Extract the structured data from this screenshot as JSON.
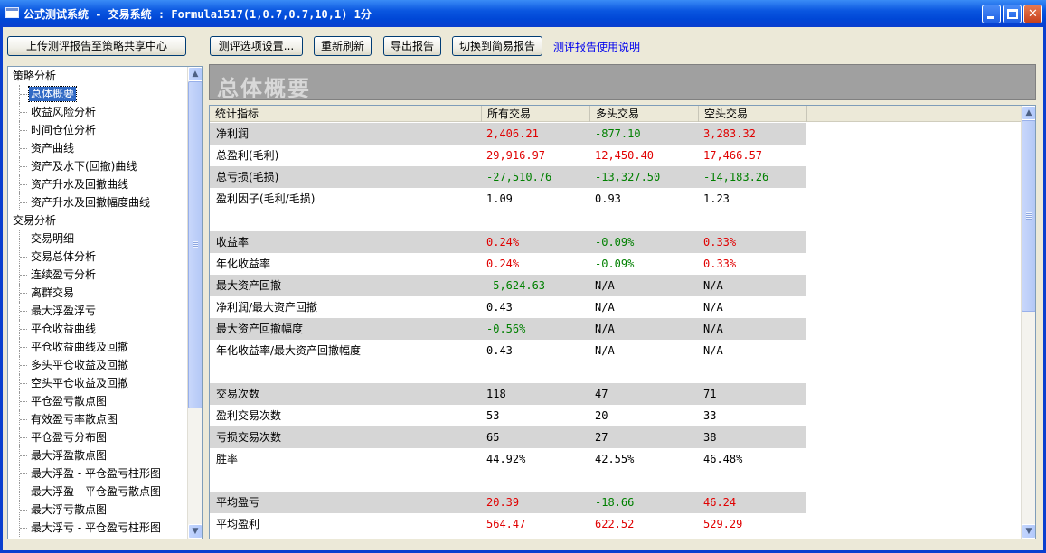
{
  "window": {
    "title": "公式测试系统 - 交易系统 : Formula1517(1,0.7,0.7,10,1) 1分"
  },
  "toolbar": {
    "upload": "上传测评报告至策略共享中心",
    "options": "测评选项设置...",
    "refresh": "重新刷新",
    "export": "导出报告",
    "simple": "切换到简易报告",
    "help_link": "测评报告使用说明"
  },
  "tree": {
    "groups": [
      {
        "label": "策略分析",
        "items": [
          "总体概要",
          "收益风险分析",
          "时间仓位分析",
          "资产曲线",
          "资产及水下(回撤)曲线",
          "资产升水及回撤曲线",
          "资产升水及回撤幅度曲线"
        ]
      },
      {
        "label": "交易分析",
        "items": [
          "交易明细",
          "交易总体分析",
          "连续盈亏分析",
          "离群交易",
          "最大浮盈浮亏",
          "平仓收益曲线",
          "平仓收益曲线及回撤",
          "多头平仓收益及回撤",
          "空头平仓收益及回撤",
          "平仓盈亏散点图",
          "有效盈亏率散点图",
          "平仓盈亏分布图",
          "最大浮盈散点图",
          "最大浮盈 - 平仓盈亏柱形图",
          "最大浮盈 - 平仓盈亏散点图",
          "最大浮亏散点图",
          "最大浮亏 - 平仓盈亏柱形图"
        ]
      }
    ],
    "selected": "总体概要"
  },
  "report": {
    "title": "总体概要",
    "headers": [
      "统计指标",
      "所有交易",
      "多头交易",
      "空头交易"
    ],
    "rows": [
      {
        "label": "净利润",
        "shaded": true,
        "values": [
          [
            "2,406.21",
            "pos"
          ],
          [
            "-877.10",
            "neg"
          ],
          [
            "3,283.32",
            "pos"
          ]
        ]
      },
      {
        "label": "总盈利(毛利)",
        "shaded": false,
        "values": [
          [
            "29,916.97",
            "pos"
          ],
          [
            "12,450.40",
            "pos"
          ],
          [
            "17,466.57",
            "pos"
          ]
        ]
      },
      {
        "label": "总亏损(毛损)",
        "shaded": true,
        "values": [
          [
            "-27,510.76",
            "neg"
          ],
          [
            "-13,327.50",
            "neg"
          ],
          [
            "-14,183.26",
            "neg"
          ]
        ]
      },
      {
        "label": "盈利因子(毛利/毛损)",
        "shaded": false,
        "values": [
          [
            "1.09",
            "neu"
          ],
          [
            "0.93",
            "neu"
          ],
          [
            "1.23",
            "neu"
          ]
        ]
      },
      {
        "label": "",
        "shaded": false,
        "values": []
      },
      {
        "label": "收益率",
        "shaded": true,
        "values": [
          [
            "0.24%",
            "pos"
          ],
          [
            "-0.09%",
            "neg"
          ],
          [
            "0.33%",
            "pos"
          ]
        ]
      },
      {
        "label": "年化收益率",
        "shaded": false,
        "values": [
          [
            "0.24%",
            "pos"
          ],
          [
            "-0.09%",
            "neg"
          ],
          [
            "0.33%",
            "pos"
          ]
        ]
      },
      {
        "label": "最大资产回撤",
        "shaded": true,
        "values": [
          [
            "-5,624.63",
            "neg"
          ],
          [
            "N/A",
            "neu"
          ],
          [
            "N/A",
            "neu"
          ]
        ]
      },
      {
        "label": "净利润/最大资产回撤",
        "shaded": false,
        "values": [
          [
            "0.43",
            "neu"
          ],
          [
            "N/A",
            "neu"
          ],
          [
            "N/A",
            "neu"
          ]
        ]
      },
      {
        "label": "最大资产回撤幅度",
        "shaded": true,
        "values": [
          [
            "-0.56%",
            "neg"
          ],
          [
            "N/A",
            "neu"
          ],
          [
            "N/A",
            "neu"
          ]
        ]
      },
      {
        "label": "年化收益率/最大资产回撤幅度",
        "shaded": false,
        "values": [
          [
            "0.43",
            "neu"
          ],
          [
            "N/A",
            "neu"
          ],
          [
            "N/A",
            "neu"
          ]
        ]
      },
      {
        "label": "",
        "shaded": false,
        "values": []
      },
      {
        "label": "交易次数",
        "shaded": true,
        "values": [
          [
            "118",
            "neu"
          ],
          [
            "47",
            "neu"
          ],
          [
            "71",
            "neu"
          ]
        ]
      },
      {
        "label": "盈利交易次数",
        "shaded": false,
        "values": [
          [
            "53",
            "neu"
          ],
          [
            "20",
            "neu"
          ],
          [
            "33",
            "neu"
          ]
        ]
      },
      {
        "label": "亏损交易次数",
        "shaded": true,
        "values": [
          [
            "65",
            "neu"
          ],
          [
            "27",
            "neu"
          ],
          [
            "38",
            "neu"
          ]
        ]
      },
      {
        "label": "胜率",
        "shaded": false,
        "values": [
          [
            "44.92%",
            "neu"
          ],
          [
            "42.55%",
            "neu"
          ],
          [
            "46.48%",
            "neu"
          ]
        ]
      },
      {
        "label": "",
        "shaded": false,
        "values": []
      },
      {
        "label": "平均盈亏",
        "shaded": true,
        "values": [
          [
            "20.39",
            "pos"
          ],
          [
            "-18.66",
            "neg"
          ],
          [
            "46.24",
            "pos"
          ]
        ]
      },
      {
        "label": "平均盈利",
        "shaded": false,
        "values": [
          [
            "564.47",
            "pos"
          ],
          [
            "622.52",
            "pos"
          ],
          [
            "529.29",
            "pos"
          ]
        ]
      }
    ]
  },
  "colors": {
    "positive": "#e00000",
    "negative": "#008000",
    "titlebar": "#0a56e0",
    "selected": "#316ac5"
  },
  "icons": {
    "minimize": "minimize-icon",
    "maximize": "maximize-icon",
    "close": "close-icon",
    "app": "window-app-icon"
  }
}
